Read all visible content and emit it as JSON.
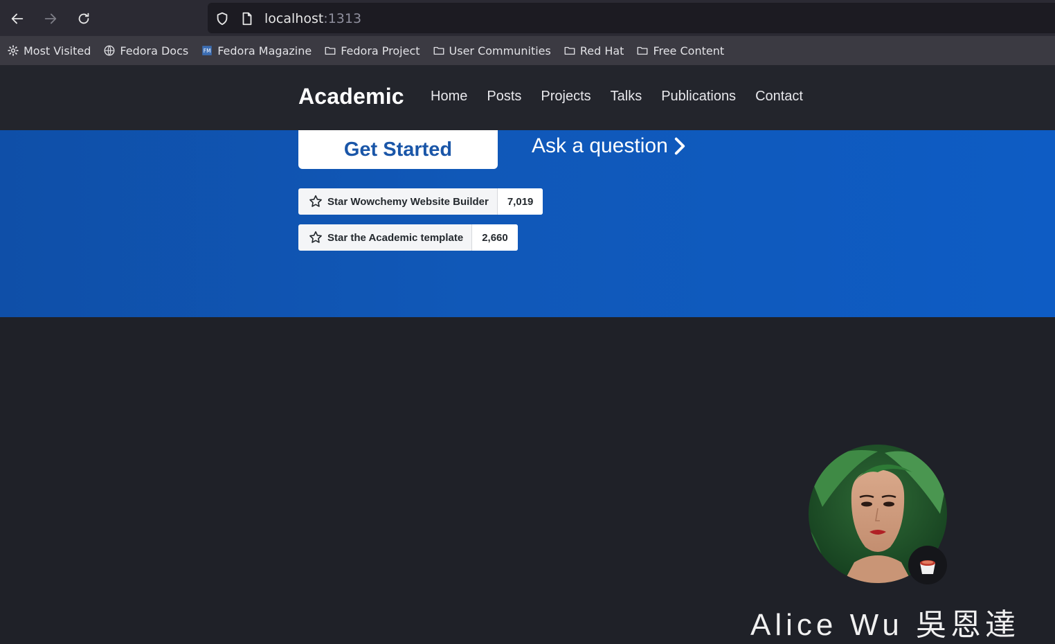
{
  "browser": {
    "url_host": "localhost",
    "url_port": ":1313",
    "bookmarks": [
      {
        "label": "Most Visited",
        "icon": "gear-icon"
      },
      {
        "label": "Fedora Docs",
        "icon": "globe-icon"
      },
      {
        "label": "Fedora Magazine",
        "icon": "magazine-icon"
      },
      {
        "label": "Fedora Project",
        "icon": "folder-icon"
      },
      {
        "label": "User Communities",
        "icon": "folder-icon"
      },
      {
        "label": "Red Hat",
        "icon": "folder-icon"
      },
      {
        "label": "Free Content",
        "icon": "folder-icon"
      }
    ]
  },
  "site": {
    "brand": "Academic",
    "nav": [
      "Home",
      "Posts",
      "Projects",
      "Talks",
      "Publications",
      "Contact"
    ]
  },
  "hero": {
    "cta_primary": "Get Started",
    "cta_secondary": "Ask a question",
    "github_buttons": [
      {
        "label": "Star Wowchemy Website Builder",
        "count": "7,019"
      },
      {
        "label": "Star the Academic template",
        "count": "2,660"
      }
    ],
    "colors": {
      "hero_bg": "#1058b8",
      "primary_text": "#1a56a8"
    }
  },
  "about": {
    "name": "Alice Wu 吳恩達",
    "avatar_icon": "portrait-photo",
    "badge_icon": "coffee-cup-emoji"
  }
}
